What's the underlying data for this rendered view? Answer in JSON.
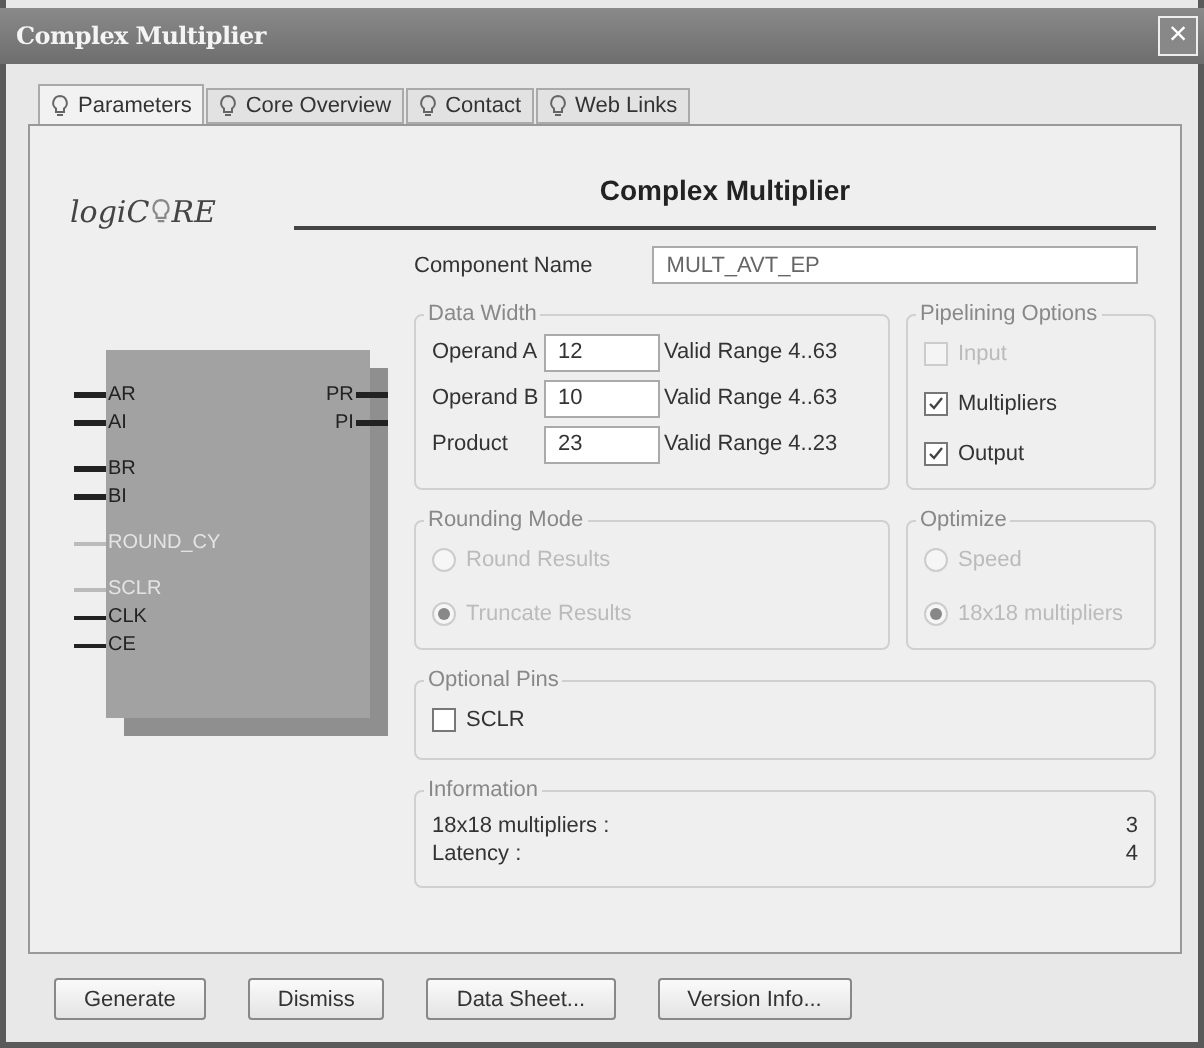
{
  "window": {
    "title": "Complex Multiplier",
    "close": "×"
  },
  "tabs": [
    {
      "label": "Parameters",
      "selected": true
    },
    {
      "label": "Core Overview",
      "selected": false
    },
    {
      "label": "Contact",
      "selected": false
    },
    {
      "label": "Web Links",
      "selected": false
    }
  ],
  "logo": {
    "before": "logiC",
    "after": "RE"
  },
  "header": "Complex Multiplier",
  "symbol": {
    "left_groups": [
      [
        {
          "name": "AR",
          "disabled": false,
          "kind": "bus"
        },
        {
          "name": "AI",
          "disabled": false,
          "kind": "bus"
        }
      ],
      [
        {
          "name": "BR",
          "disabled": false,
          "kind": "bus"
        },
        {
          "name": "BI",
          "disabled": false,
          "kind": "bus"
        }
      ],
      [
        {
          "name": "ROUND_CY",
          "disabled": true,
          "kind": "signal"
        }
      ],
      [
        {
          "name": "SCLR",
          "disabled": true,
          "kind": "signal"
        },
        {
          "name": "CLK",
          "disabled": false,
          "kind": "signal"
        },
        {
          "name": "CE",
          "disabled": false,
          "kind": "signal"
        }
      ]
    ],
    "right": [
      {
        "name": "PR",
        "disabled": false,
        "kind": "bus"
      },
      {
        "name": "PI",
        "disabled": false,
        "kind": "bus"
      }
    ]
  },
  "component_name": {
    "label": "Component Name",
    "value": "MULT_AVT_EP"
  },
  "data_width": {
    "title": "Data Width",
    "rows": [
      {
        "label": "Operand A",
        "value": "12",
        "range": "Valid Range 4..63"
      },
      {
        "label": "Operand B",
        "value": "10",
        "range": "Valid Range 4..63"
      },
      {
        "label": "Product",
        "value": "23",
        "range": "Valid Range 4..23"
      }
    ]
  },
  "pipelining": {
    "title": "Pipelining Options",
    "options": [
      {
        "label": "Input",
        "checked": false,
        "disabled": true
      },
      {
        "label": "Multipliers",
        "checked": true,
        "disabled": false
      },
      {
        "label": "Output",
        "checked": true,
        "disabled": false
      }
    ]
  },
  "rounding": {
    "title": "Rounding Mode",
    "disabled": true,
    "options": [
      {
        "label": "Round Results",
        "selected": false
      },
      {
        "label": "Truncate Results",
        "selected": true
      }
    ]
  },
  "optimize": {
    "title": "Optimize",
    "disabled": true,
    "options": [
      {
        "label": "Speed",
        "selected": false
      },
      {
        "label": "18x18 multipliers",
        "selected": true
      }
    ]
  },
  "optional_pins": {
    "title": "Optional Pins",
    "options": [
      {
        "label": "SCLR",
        "checked": false,
        "disabled": false
      }
    ]
  },
  "information": {
    "title": "Information",
    "rows": [
      {
        "label": "18x18 multipliers :",
        "value": "3"
      },
      {
        "label": "Latency :",
        "value": "4"
      }
    ]
  },
  "buttons": [
    "Generate",
    "Dismiss",
    "Data Sheet...",
    "Version Info..."
  ]
}
